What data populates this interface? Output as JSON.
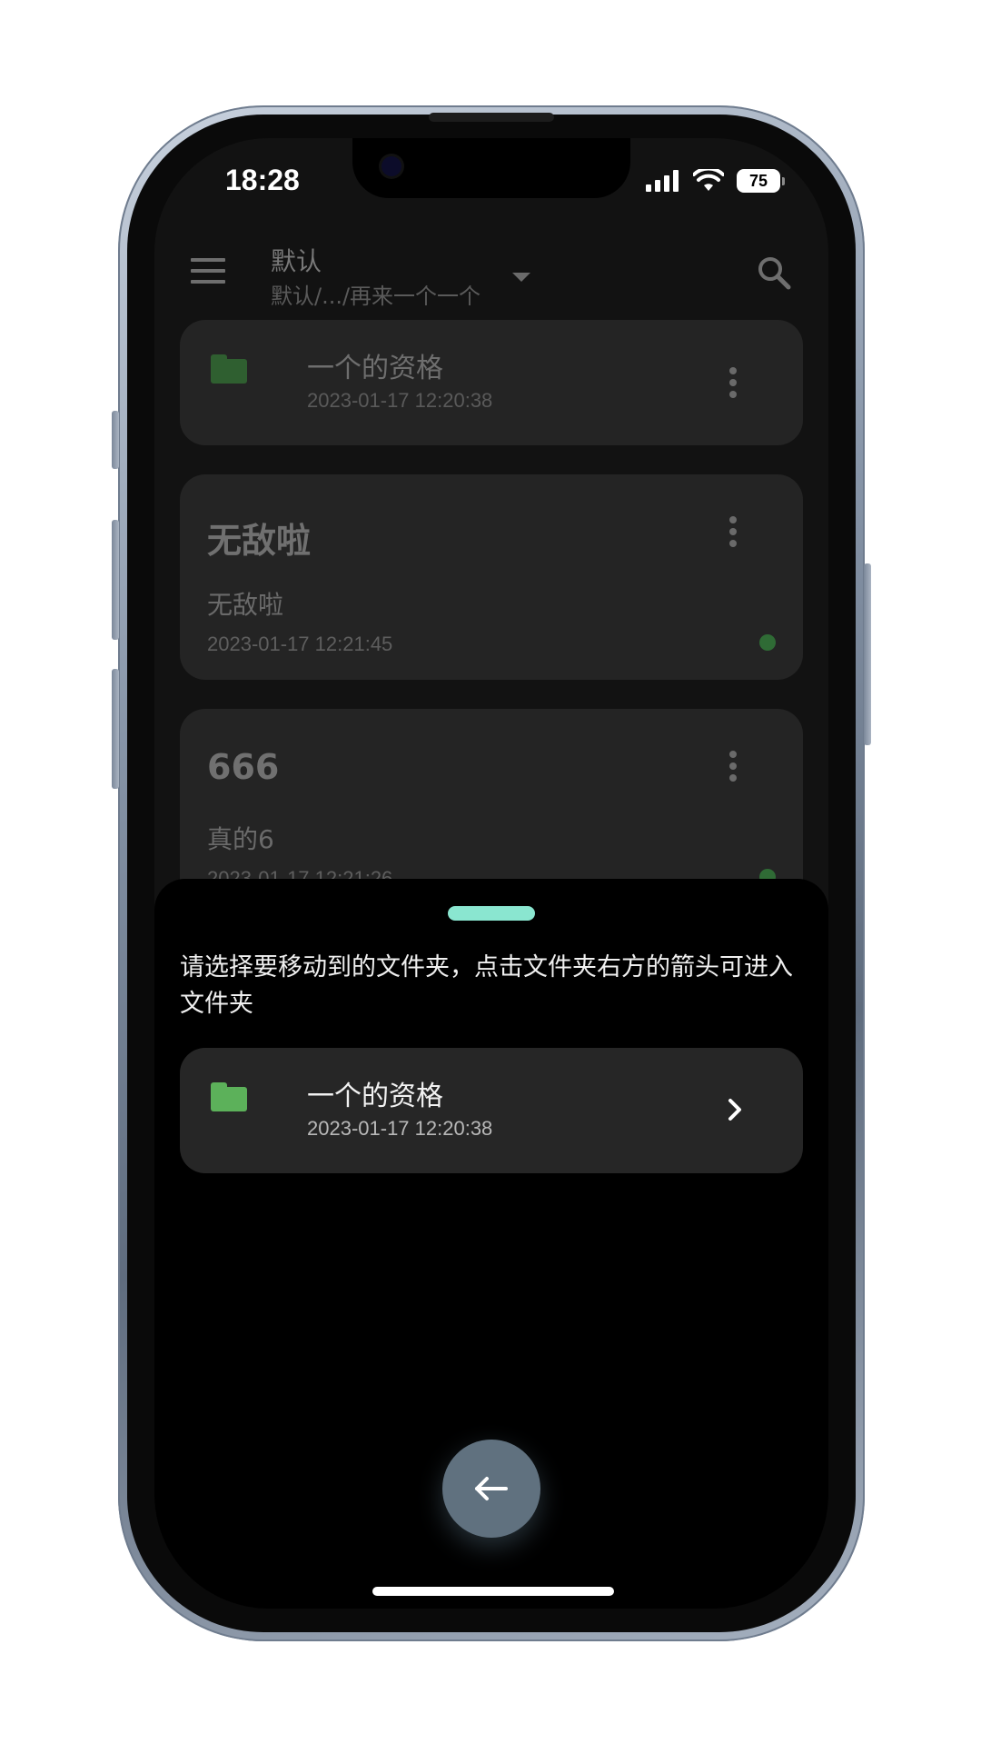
{
  "status_bar": {
    "time": "18:28",
    "battery": "75"
  },
  "app_bar": {
    "title": "默认",
    "subtitle": "默认/.../再来一个一个",
    "menu_icon": "menu-icon",
    "search_icon": "search-icon"
  },
  "list": {
    "folder": {
      "name": "一个的资格",
      "date": "2023-01-17 12:20:38",
      "icon": "folder-icon"
    },
    "notes": [
      {
        "title": "无敌啦",
        "body": "无敌啦",
        "date": "2023-01-17 12:21:45"
      },
      {
        "title": "666",
        "body": "真的6",
        "date": "2023-01-17 12:21:26"
      }
    ]
  },
  "move_sheet": {
    "hint": "请选择要移动到的文件夹，点击文件夹右方的箭头可进入文件夹",
    "folder": {
      "name": "一个的资格",
      "date": "2023-01-17 12:20:38"
    },
    "back_button_icon": "arrow-left-icon"
  },
  "colors": {
    "folder_dim": "#2f5f30",
    "folder_bright": "#5cb15a",
    "sheet_handle": "#8ae6d0",
    "fab": "#60717f",
    "sync_dot": "#2f6b35"
  }
}
